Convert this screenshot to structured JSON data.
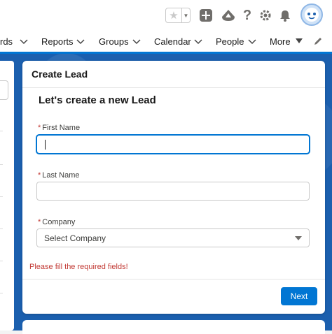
{
  "nav": {
    "items": [
      "rds",
      "Reports",
      "Groups",
      "Calendar",
      "People",
      "More"
    ]
  },
  "modal": {
    "title": "Create Lead",
    "subtitle": "Let's create a new Lead",
    "required_marker": "*",
    "fields": {
      "first_name": {
        "label": "First Name",
        "value": ""
      },
      "last_name": {
        "label": "Last Name",
        "value": ""
      },
      "company": {
        "label": "Company",
        "placeholder": "Select Company"
      }
    },
    "error": "Please fill the required fields!",
    "next_label": "Next"
  },
  "icons": {
    "favorite": "star-icon",
    "favorite_menu": "caret-down-icon",
    "add": "plus-square-icon",
    "trailhead": "trailhead-icon",
    "help": "help-icon",
    "settings": "gear-icon",
    "notifications": "bell-icon",
    "avatar": "astro-avatar"
  },
  "colors": {
    "brand": "#0176d3",
    "error": "#c23934",
    "background_band": "#1b5fae"
  }
}
